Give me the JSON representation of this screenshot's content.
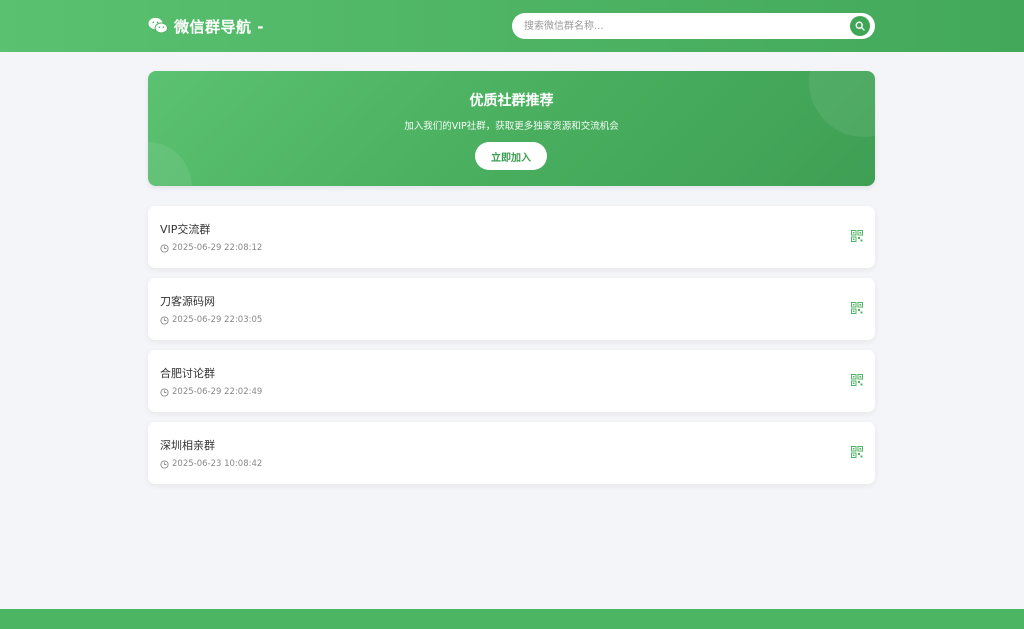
{
  "header": {
    "brand_title": "微信群导航 -",
    "search_placeholder": "搜索微信群名称..."
  },
  "banner": {
    "title": "优质社群推荐",
    "subtitle": "加入我们的VIP社群，获取更多独家资源和交流机会",
    "join_label": "立即加入"
  },
  "groups": [
    {
      "name": "VIP交流群",
      "time": "2025-06-29 22:08:12"
    },
    {
      "name": "刀客源码网",
      "time": "2025-06-29 22:03:05"
    },
    {
      "name": "合肥讨论群",
      "time": "2025-06-29 22:02:49"
    },
    {
      "name": "深圳相亲群",
      "time": "2025-06-23 10:08:42"
    }
  ],
  "colors": {
    "primary_green": "#4cb563",
    "background": "#f4f5f9"
  },
  "icons": {
    "brand": "wechat-icon",
    "search": "search-icon",
    "time": "clock-icon",
    "qr": "qrcode-icon"
  }
}
